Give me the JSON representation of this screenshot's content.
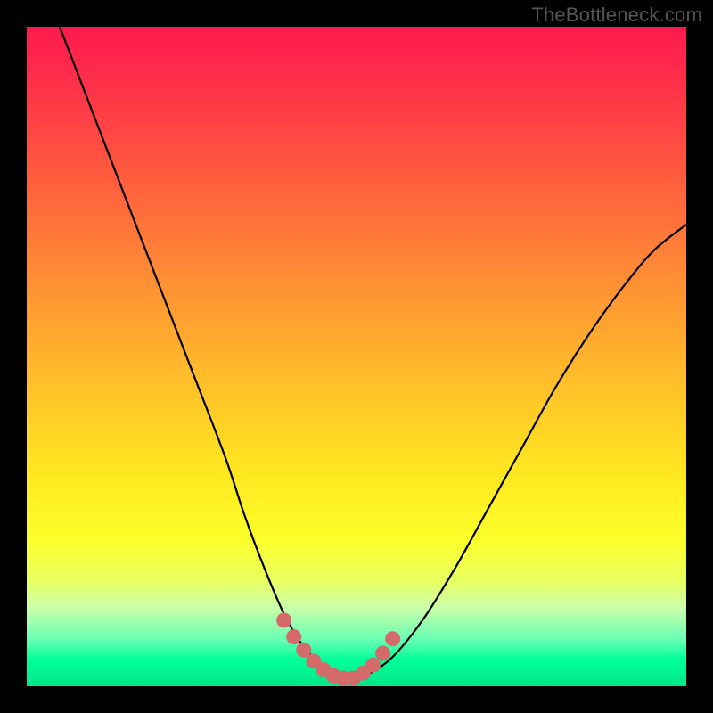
{
  "watermark": "TheBottleneck.com",
  "colors": {
    "frame": "#000000",
    "gradient_top": "#ff1a4d",
    "gradient_bottom": "#00e68a",
    "curve": "#000000",
    "marker": "#d46a6a"
  },
  "chart_data": {
    "type": "line",
    "title": "",
    "xlabel": "",
    "ylabel": "",
    "xlim": [
      0,
      100
    ],
    "ylim": [
      0,
      100
    ],
    "grid": false,
    "legend": false,
    "annotations": [],
    "series": [
      {
        "name": "bottleneck-curve",
        "x": [
          5,
          10,
          15,
          20,
          25,
          30,
          33,
          36,
          39,
          42,
          46,
          48,
          50,
          55,
          60,
          65,
          70,
          75,
          80,
          85,
          90,
          95,
          100
        ],
        "y": [
          100,
          87,
          74,
          61,
          48,
          35,
          26,
          18,
          11,
          6,
          2,
          1,
          1,
          4,
          10,
          18,
          27,
          36,
          45,
          53,
          60,
          66,
          70
        ]
      }
    ],
    "markers": {
      "comment": "salmon dotted segments near curve minimum",
      "points_x": [
        39,
        40.5,
        42,
        43.5,
        45,
        46.5,
        48,
        49.5,
        51,
        52.5,
        54,
        55.5
      ],
      "points_y": [
        10,
        7.5,
        5.5,
        3.8,
        2.5,
        1.6,
        1.2,
        1.2,
        2.0,
        3.2,
        5.0,
        7.2
      ]
    }
  }
}
